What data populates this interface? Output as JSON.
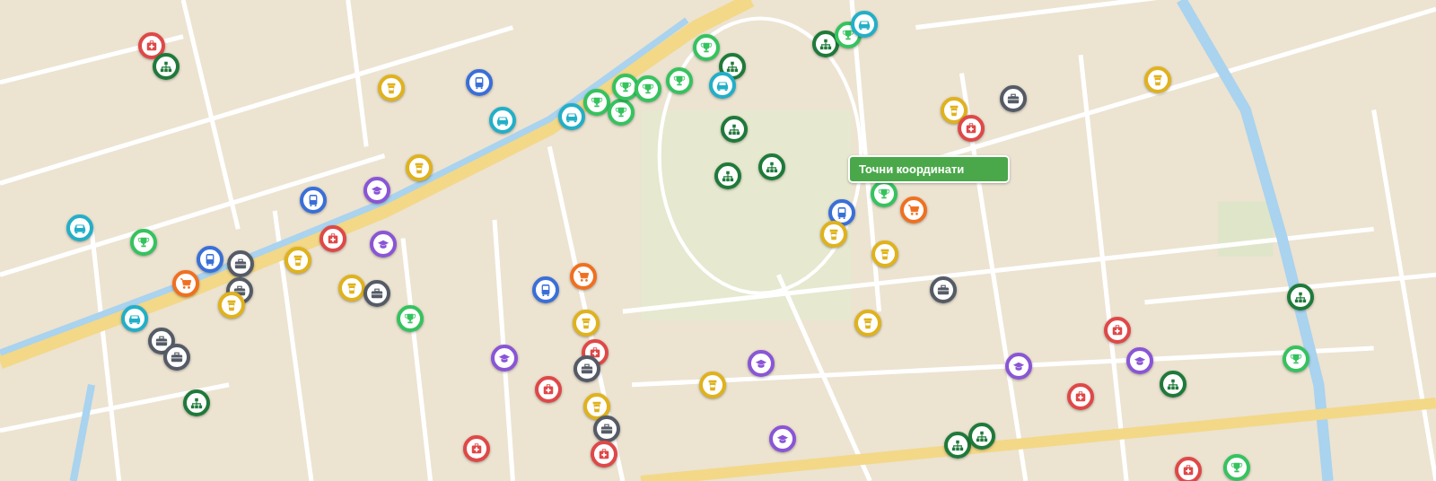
{
  "tooltip": {
    "label": "Точни координати"
  },
  "pins": [
    {
      "kind": "medical",
      "color": "#e04848"
    },
    {
      "kind": "org",
      "color": "#1f7a3a"
    },
    {
      "kind": "cup",
      "color": "#e0b21c"
    },
    {
      "kind": "bus",
      "color": "#3a6fd8"
    },
    {
      "kind": "car",
      "color": "#22afc8"
    },
    {
      "kind": "car",
      "color": "#22afc8"
    },
    {
      "kind": "trophy",
      "color": "#35c35e"
    },
    {
      "kind": "trophy",
      "color": "#35c35e"
    },
    {
      "kind": "trophy",
      "color": "#35c35e"
    },
    {
      "kind": "trophy",
      "color": "#35c35e"
    },
    {
      "kind": "trophy",
      "color": "#35c35e"
    },
    {
      "kind": "trophy",
      "color": "#35c35e"
    },
    {
      "kind": "org",
      "color": "#1f7a3a"
    },
    {
      "kind": "car",
      "color": "#22afc8"
    },
    {
      "kind": "org",
      "color": "#1f7a3a"
    },
    {
      "kind": "trophy",
      "color": "#35c35e"
    },
    {
      "kind": "car",
      "color": "#22afc8"
    },
    {
      "kind": "briefcase",
      "color": "#555b66"
    },
    {
      "kind": "cup",
      "color": "#e0b21c"
    },
    {
      "kind": "medical",
      "color": "#e04848"
    },
    {
      "kind": "cup",
      "color": "#e0b21c"
    },
    {
      "kind": "org",
      "color": "#1f7a3a"
    },
    {
      "kind": "org",
      "color": "#1f7a3a"
    },
    {
      "kind": "org",
      "color": "#1f7a3a"
    },
    {
      "kind": "cup",
      "color": "#e0b21c"
    },
    {
      "kind": "education",
      "color": "#8a55d6"
    },
    {
      "kind": "bus",
      "color": "#3a6fd8"
    },
    {
      "kind": "car",
      "color": "#22afc8"
    },
    {
      "kind": "trophy",
      "color": "#35c35e"
    },
    {
      "kind": "bus",
      "color": "#3a6fd8"
    },
    {
      "kind": "briefcase",
      "color": "#555b66"
    },
    {
      "kind": "shop",
      "color": "#f07020"
    },
    {
      "kind": "briefcase",
      "color": "#555b66"
    },
    {
      "kind": "cup",
      "color": "#e0b21c"
    },
    {
      "kind": "car",
      "color": "#22afc8"
    },
    {
      "kind": "briefcase",
      "color": "#555b66"
    },
    {
      "kind": "briefcase",
      "color": "#555b66"
    },
    {
      "kind": "org",
      "color": "#1f7a3a"
    },
    {
      "kind": "medical",
      "color": "#e04848"
    },
    {
      "kind": "education",
      "color": "#8a55d6"
    },
    {
      "kind": "cup",
      "color": "#e0b21c"
    },
    {
      "kind": "cup",
      "color": "#e0b21c"
    },
    {
      "kind": "briefcase",
      "color": "#555b66"
    },
    {
      "kind": "trophy",
      "color": "#35c35e"
    },
    {
      "kind": "bus",
      "color": "#3a6fd8"
    },
    {
      "kind": "shop",
      "color": "#f07020"
    },
    {
      "kind": "cup",
      "color": "#e0b21c"
    },
    {
      "kind": "medical",
      "color": "#e04848"
    },
    {
      "kind": "briefcase",
      "color": "#555b66"
    },
    {
      "kind": "education",
      "color": "#8a55d6"
    },
    {
      "kind": "medical",
      "color": "#e04848"
    },
    {
      "kind": "cup",
      "color": "#e0b21c"
    },
    {
      "kind": "briefcase",
      "color": "#555b66"
    },
    {
      "kind": "medical",
      "color": "#e04848"
    },
    {
      "kind": "medical",
      "color": "#e04848"
    },
    {
      "kind": "cup",
      "color": "#e0b21c"
    },
    {
      "kind": "education",
      "color": "#8a55d6"
    },
    {
      "kind": "education",
      "color": "#8a55d6"
    },
    {
      "kind": "trophy",
      "color": "#35c35e"
    },
    {
      "kind": "shop",
      "color": "#f07020"
    },
    {
      "kind": "bus",
      "color": "#3a6fd8"
    },
    {
      "kind": "cup",
      "color": "#e0b21c"
    },
    {
      "kind": "cup",
      "color": "#e0b21c"
    },
    {
      "kind": "briefcase",
      "color": "#555b66"
    },
    {
      "kind": "cup",
      "color": "#e0b21c"
    },
    {
      "kind": "medical",
      "color": "#e04848"
    },
    {
      "kind": "education",
      "color": "#8a55d6"
    },
    {
      "kind": "education",
      "color": "#8a55d6"
    },
    {
      "kind": "medical",
      "color": "#e04848"
    },
    {
      "kind": "org",
      "color": "#1f7a3a"
    },
    {
      "kind": "trophy",
      "color": "#35c35e"
    },
    {
      "kind": "org",
      "color": "#1f7a3a"
    },
    {
      "kind": "org",
      "color": "#1f7a3a"
    },
    {
      "kind": "org",
      "color": "#1f7a3a"
    },
    {
      "kind": "medical",
      "color": "#e04848"
    },
    {
      "kind": "trophy",
      "color": "#35c35e"
    }
  ]
}
